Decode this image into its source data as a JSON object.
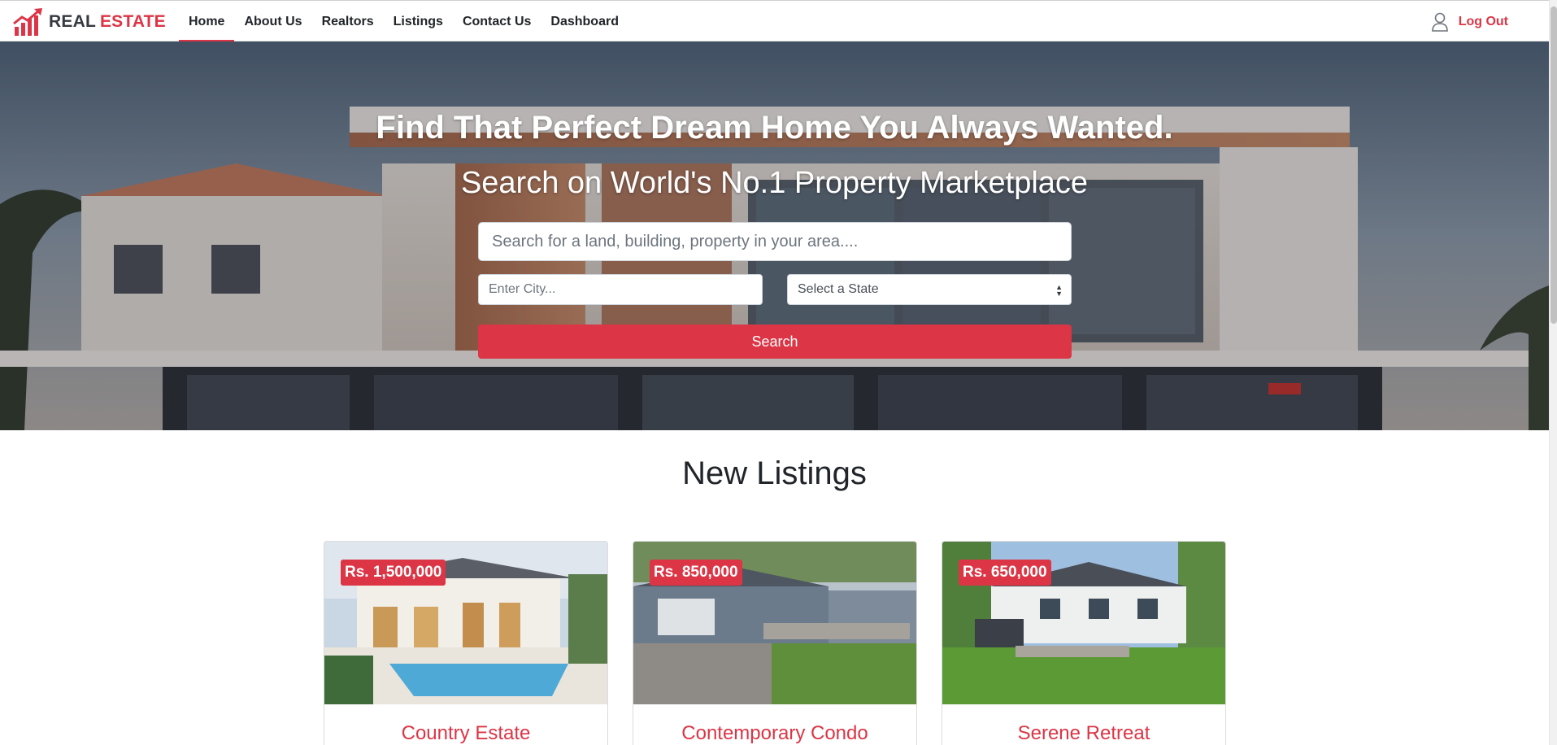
{
  "brand": {
    "part1": "REAL",
    "part2": "ESTATE"
  },
  "nav": {
    "links": [
      {
        "label": "Home",
        "active": true
      },
      {
        "label": "About Us"
      },
      {
        "label": "Realtors"
      },
      {
        "label": "Listings"
      },
      {
        "label": "Contact Us"
      },
      {
        "label": "Dashboard"
      }
    ],
    "logout_label": "Log Out",
    "user_icon": "user-icon"
  },
  "hero": {
    "title": "Find That Perfect Dream Home You Always Wanted.",
    "subtitle": "Search on World's No.1 Property Marketplace",
    "search_placeholder": "Search for a land, building, property in your area....",
    "city_placeholder": "Enter City...",
    "state_selected": "Select a State",
    "search_button": "Search"
  },
  "listings": {
    "section_title": "New Listings",
    "cards": [
      {
        "price": "Rs. 1,500,000",
        "title": "Country Estate"
      },
      {
        "price": "Rs. 850,000",
        "title": "Contemporary Condo"
      },
      {
        "price": "Rs. 650,000",
        "title": "Serene Retreat"
      }
    ]
  },
  "colors": {
    "accent": "#dc3545",
    "dark": "#343a40"
  }
}
